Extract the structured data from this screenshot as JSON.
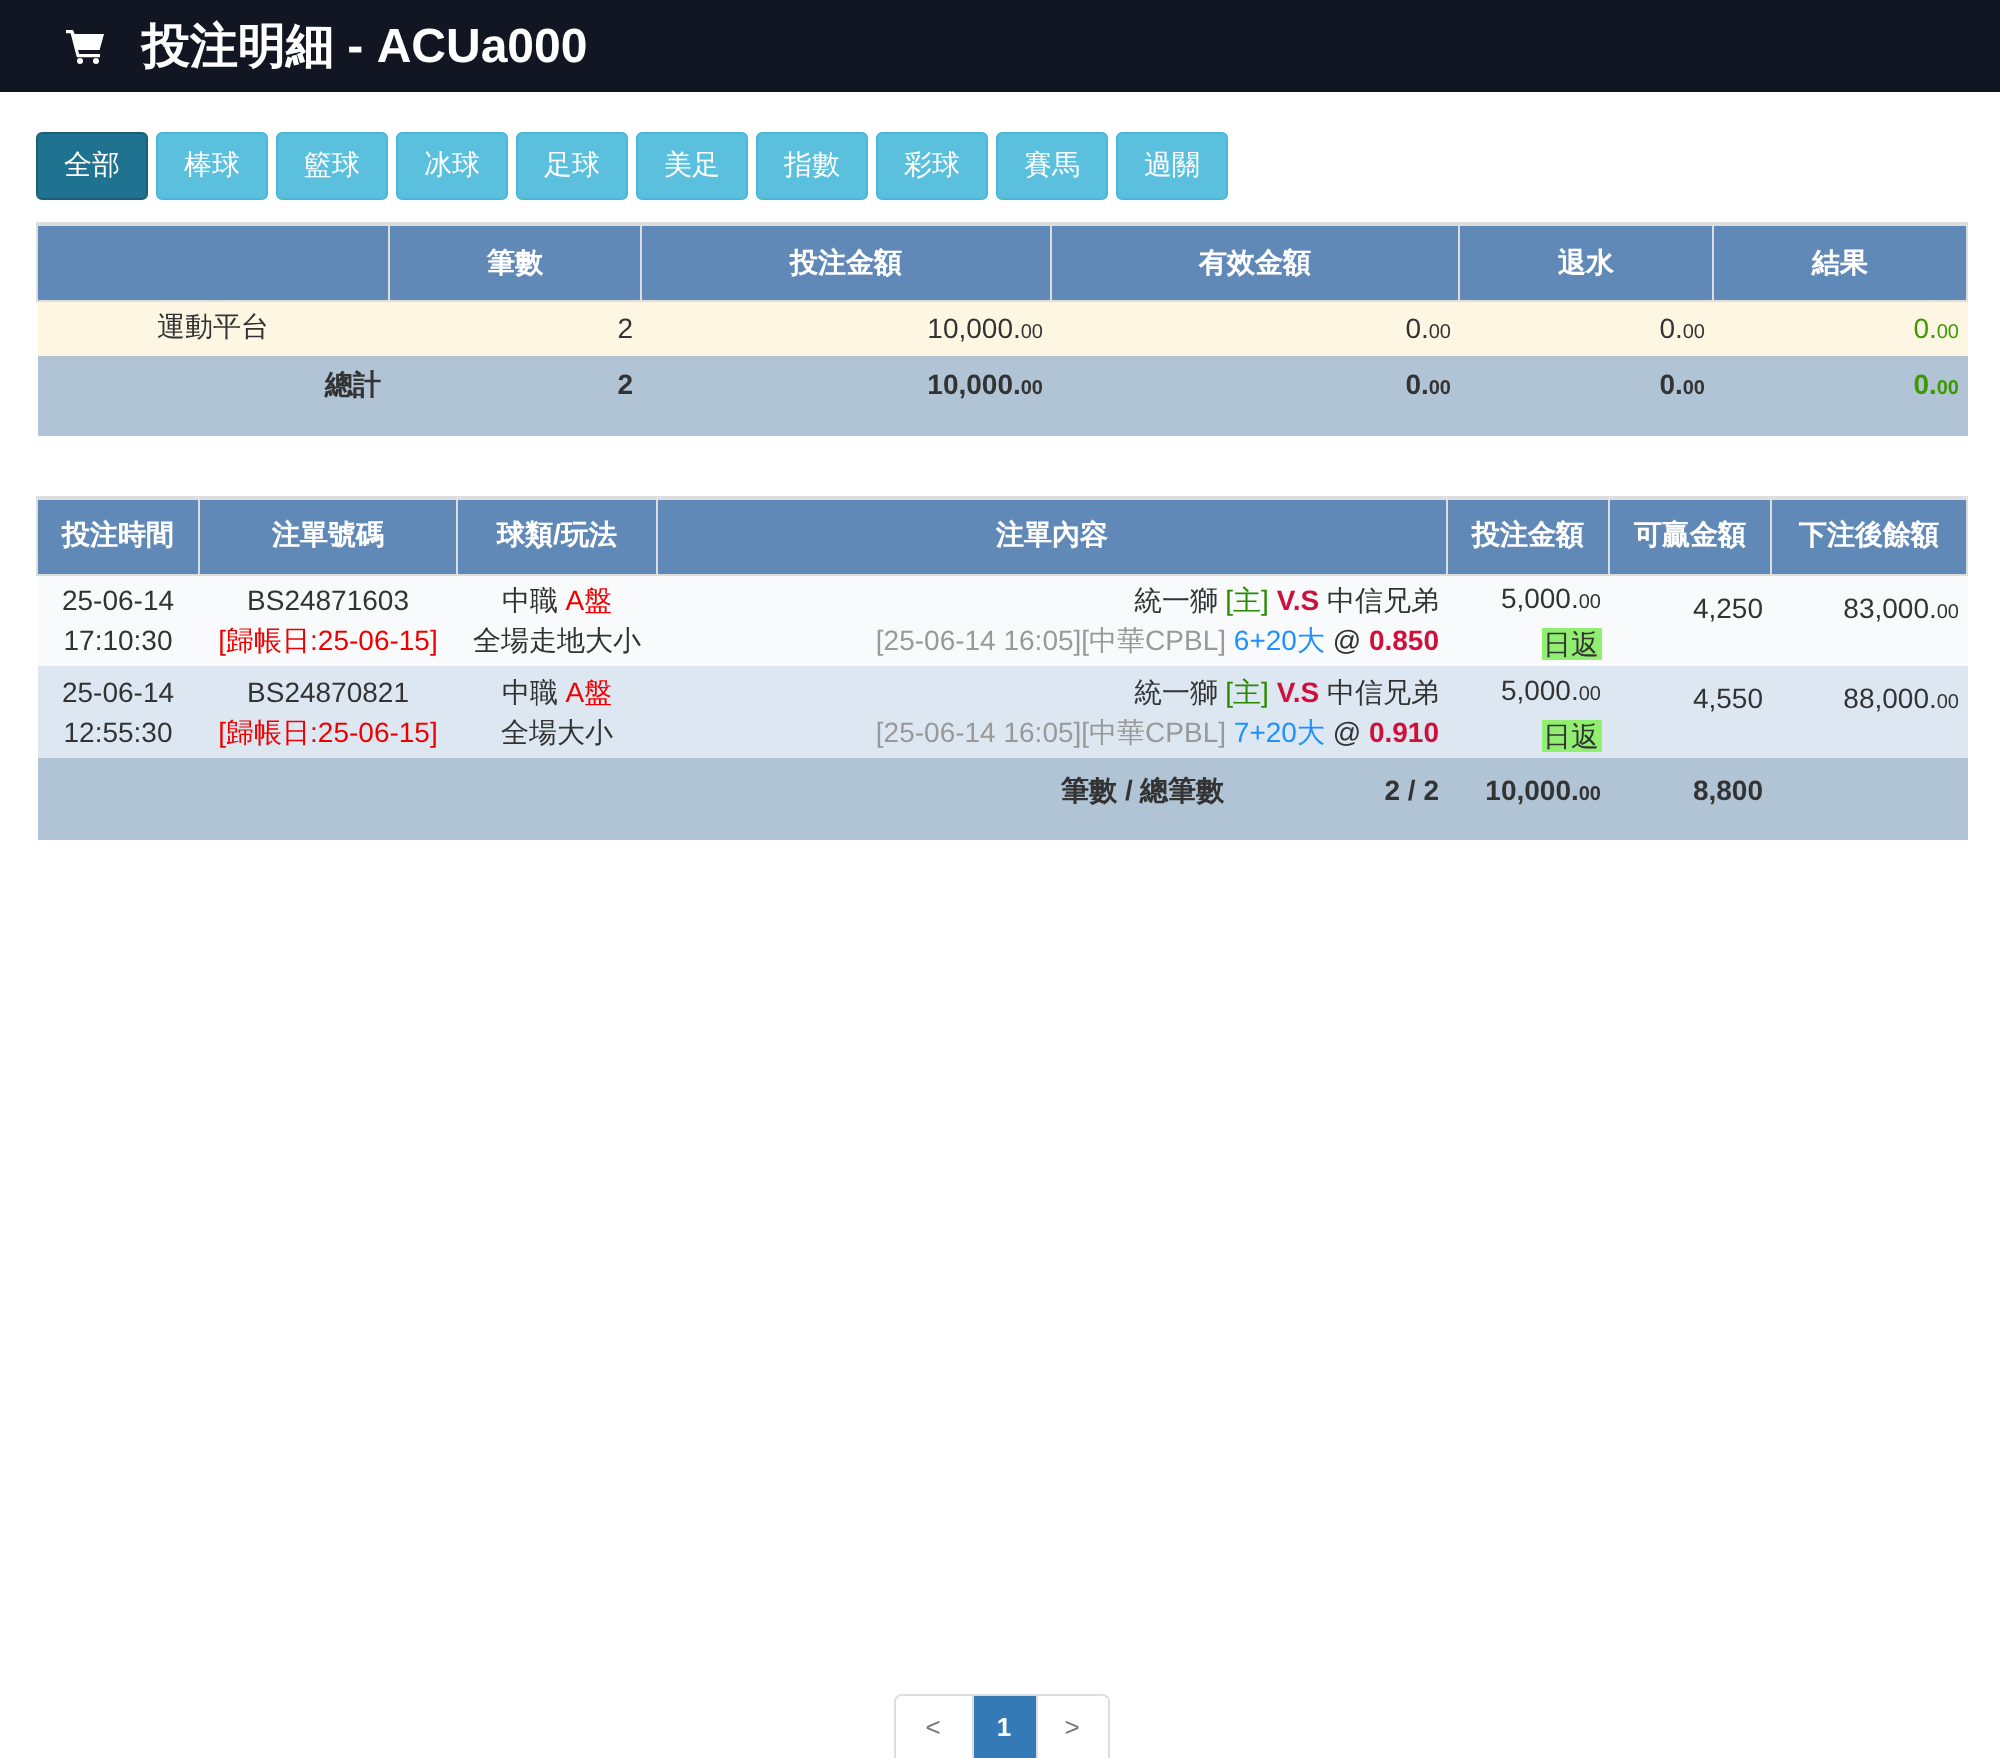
{
  "header": {
    "title": "投注明細 - ACUa000"
  },
  "tabs": [
    {
      "label": "全部",
      "selected": true
    },
    {
      "label": "棒球",
      "selected": false
    },
    {
      "label": "籃球",
      "selected": false
    },
    {
      "label": "冰球",
      "selected": false
    },
    {
      "label": "足球",
      "selected": false
    },
    {
      "label": "美足",
      "selected": false
    },
    {
      "label": "指數",
      "selected": false
    },
    {
      "label": "彩球",
      "selected": false
    },
    {
      "label": "賽馬",
      "selected": false
    },
    {
      "label": "過關",
      "selected": false
    }
  ],
  "summary": {
    "columns": [
      "",
      "筆數",
      "投注金額",
      "有效金額",
      "退水",
      "結果"
    ],
    "rows": [
      {
        "name": "運動平台",
        "count": "2",
        "bet": {
          "whole": "10,000.",
          "fraction": "00"
        },
        "valid": {
          "whole": "0.",
          "fraction": "00"
        },
        "rebate": {
          "whole": "0.",
          "fraction": "00"
        },
        "result": {
          "whole": "0.",
          "fraction": "00"
        }
      }
    ],
    "total": {
      "name": "總計",
      "count": "2",
      "bet": {
        "whole": "10,000.",
        "fraction": "00"
      },
      "valid": {
        "whole": "0.",
        "fraction": "00"
      },
      "rebate": {
        "whole": "0.",
        "fraction": "00"
      },
      "result": {
        "whole": "0.",
        "fraction": "00"
      }
    }
  },
  "bets": {
    "columns": [
      "投注時間",
      "注單號碼",
      "球類/玩法",
      "注單內容",
      "投注金額",
      "可贏金額",
      "下注後餘額"
    ],
    "rows": [
      {
        "date": "25-06-14",
        "time": "17:10:30",
        "ticket": "BS24871603",
        "settle_date": "[歸帳日:25-06-15]",
        "league": "中職",
        "market": "A盤",
        "play": "全場走地大小",
        "home": "統一獅",
        "home_tag": "[主]",
        "vs": "V.S",
        "away": "中信兄弟",
        "event": "[25-06-14 16:05][中華CPBL]",
        "pick": "6+20大",
        "at": "@",
        "odds": "0.850",
        "amount": {
          "whole": "5,000.",
          "fraction": "00"
        },
        "tag": "日返",
        "win": "4,250",
        "balance": {
          "whole": "83,000.",
          "fraction": "00"
        }
      },
      {
        "date": "25-06-14",
        "time": "12:55:30",
        "ticket": "BS24870821",
        "settle_date": "[歸帳日:25-06-15]",
        "league": "中職",
        "market": "A盤",
        "play": "全場大小",
        "home": "統一獅",
        "home_tag": "[主]",
        "vs": "V.S",
        "away": "中信兄弟",
        "event": "[25-06-14 16:05][中華CPBL]",
        "pick": "7+20大",
        "at": "@",
        "odds": "0.910",
        "amount": {
          "whole": "5,000.",
          "fraction": "00"
        },
        "tag": "日返",
        "win": "4,550",
        "balance": {
          "whole": "88,000.",
          "fraction": "00"
        }
      }
    ],
    "footer": {
      "label": "筆數 / 總筆數",
      "count": "2 / 2",
      "amount": {
        "whole": "10,000.",
        "fraction": "00"
      },
      "win": "8,800"
    }
  },
  "pagination": [
    {
      "label": "<",
      "kind": "prev",
      "selected": false
    },
    {
      "label": "1",
      "kind": "page",
      "selected": true
    },
    {
      "label": ">",
      "kind": "next",
      "selected": false
    }
  ]
}
